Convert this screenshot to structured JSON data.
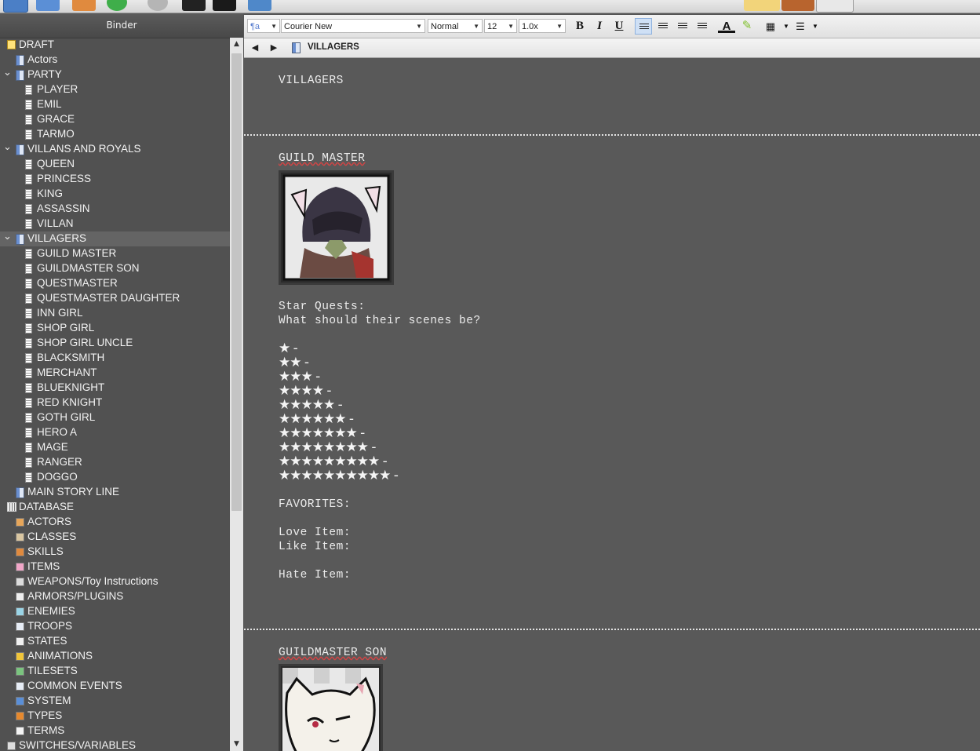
{
  "binder": {
    "header": "Binder",
    "items": [
      {
        "label": "DRAFT",
        "level": 0,
        "icon": "draft-icon",
        "expand": ""
      },
      {
        "label": "Actors",
        "level": 1,
        "icon": "folder-icon",
        "expand": ""
      },
      {
        "label": "PARTY",
        "level": 1,
        "icon": "folder-icon",
        "expand": "open"
      },
      {
        "label": "PLAYER",
        "level": 2,
        "icon": "document-icon",
        "expand": ""
      },
      {
        "label": "EMIL",
        "level": 2,
        "icon": "document-icon",
        "expand": ""
      },
      {
        "label": "GRACE",
        "level": 2,
        "icon": "document-icon",
        "expand": ""
      },
      {
        "label": "TARMO",
        "level": 2,
        "icon": "document-icon",
        "expand": ""
      },
      {
        "label": "VILLANS AND ROYALS",
        "level": 1,
        "icon": "folder-icon",
        "expand": "open"
      },
      {
        "label": "QUEEN",
        "level": 2,
        "icon": "document-icon",
        "expand": ""
      },
      {
        "label": "PRINCESS",
        "level": 2,
        "icon": "document-icon",
        "expand": ""
      },
      {
        "label": "KING",
        "level": 2,
        "icon": "document-icon",
        "expand": ""
      },
      {
        "label": "ASSASSIN",
        "level": 2,
        "icon": "document-icon",
        "expand": ""
      },
      {
        "label": "VILLAN",
        "level": 2,
        "icon": "document-icon",
        "expand": ""
      },
      {
        "label": "VILLAGERS",
        "level": 1,
        "icon": "folder-icon",
        "expand": "open",
        "selected": true
      },
      {
        "label": "GUILD MASTER",
        "level": 2,
        "icon": "document-icon",
        "expand": ""
      },
      {
        "label": "GUILDMASTER SON",
        "level": 2,
        "icon": "document-icon",
        "expand": ""
      },
      {
        "label": "QUESTMASTER",
        "level": 2,
        "icon": "document-icon",
        "expand": ""
      },
      {
        "label": "QUESTMASTER DAUGHTER",
        "level": 2,
        "icon": "document-icon",
        "expand": ""
      },
      {
        "label": "INN GIRL",
        "level": 2,
        "icon": "document-icon",
        "expand": ""
      },
      {
        "label": "SHOP GIRL",
        "level": 2,
        "icon": "document-icon",
        "expand": ""
      },
      {
        "label": "SHOP GIRL UNCLE",
        "level": 2,
        "icon": "document-icon",
        "expand": ""
      },
      {
        "label": "BLACKSMITH",
        "level": 2,
        "icon": "document-icon",
        "expand": ""
      },
      {
        "label": "MERCHANT",
        "level": 2,
        "icon": "document-icon",
        "expand": ""
      },
      {
        "label": "BLUEKNIGHT",
        "level": 2,
        "icon": "document-icon",
        "expand": ""
      },
      {
        "label": "RED KNIGHT",
        "level": 2,
        "icon": "document-icon",
        "expand": ""
      },
      {
        "label": "GOTH GIRL",
        "level": 2,
        "icon": "document-icon",
        "expand": ""
      },
      {
        "label": "HERO A",
        "level": 2,
        "icon": "document-icon",
        "expand": ""
      },
      {
        "label": "MAGE",
        "level": 2,
        "icon": "document-icon",
        "expand": ""
      },
      {
        "label": "RANGER",
        "level": 2,
        "icon": "document-icon",
        "expand": ""
      },
      {
        "label": "DOGGO",
        "level": 2,
        "icon": "document-icon",
        "expand": ""
      },
      {
        "label": "MAIN STORY LINE",
        "level": 1,
        "icon": "folder-icon",
        "expand": ""
      },
      {
        "label": "DATABASE",
        "level": 0,
        "icon": "grid-icon",
        "expand": ""
      },
      {
        "label": "ACTORS",
        "level": 1,
        "icon": "actor-icon",
        "expand": ""
      },
      {
        "label": "CLASSES",
        "level": 1,
        "icon": "class-icon",
        "expand": ""
      },
      {
        "label": "SKILLS",
        "level": 1,
        "icon": "skill-icon",
        "expand": ""
      },
      {
        "label": "ITEMS",
        "level": 1,
        "icon": "potion-icon",
        "expand": ""
      },
      {
        "label": "WEAPONS/Toy Instructions",
        "level": 1,
        "icon": "weapon-icon",
        "expand": ""
      },
      {
        "label": "ARMORS/PLUGINS",
        "level": 1,
        "icon": "armor-icon",
        "expand": ""
      },
      {
        "label": "ENEMIES",
        "level": 1,
        "icon": "eye-icon",
        "expand": ""
      },
      {
        "label": "TROOPS",
        "level": 1,
        "icon": "troops-icon",
        "expand": ""
      },
      {
        "label": "STATES",
        "level": 1,
        "icon": "states-icon",
        "expand": ""
      },
      {
        "label": "ANIMATIONS",
        "level": 1,
        "icon": "star-icon",
        "expand": ""
      },
      {
        "label": "TILESETS",
        "level": 1,
        "icon": "tileset-icon",
        "expand": ""
      },
      {
        "label": "COMMON EVENTS",
        "level": 1,
        "icon": "events-icon",
        "expand": ""
      },
      {
        "label": "SYSTEM",
        "level": 1,
        "icon": "system-icon",
        "expand": ""
      },
      {
        "label": "TYPES",
        "level": 1,
        "icon": "types-icon",
        "expand": ""
      },
      {
        "label": "TERMS",
        "level": 1,
        "icon": "terms-icon",
        "expand": ""
      },
      {
        "label": "SWITCHES/VARIABLES",
        "level": 0,
        "icon": "switch-icon",
        "expand": ""
      }
    ]
  },
  "format": {
    "style_icon": "¶a",
    "font": "Courier New",
    "paragraph_style": "Normal",
    "size": "12",
    "spacing": "1.0x",
    "bold": "B",
    "italic": "I",
    "underline": "U",
    "text_color_glyph": "A"
  },
  "nav": {
    "title": "VILLAGERS"
  },
  "editor": {
    "heading": "VILLAGERS",
    "guild_master": {
      "name": "GUILD MASTER",
      "star_quests": "Star Quests:",
      "question": "What should their scenes be?",
      "star_rows": [
        "★ -",
        "★★ -",
        "★★★ -",
        "★★★★ -",
        "★★★★★ -",
        "★★★★★★ -",
        "★★★★★★★ -",
        "★★★★★★★★ -",
        "★★★★★★★★★ -",
        "★★★★★★★★★★ -"
      ],
      "favorites": "FAVORITES:",
      "love": "Love Item:",
      "like": "Like Item:",
      "hate": "Hate Item:"
    },
    "guildmaster_son": {
      "name": "GUILDMASTER SON"
    }
  },
  "colors": {
    "background": "#555555",
    "editor_bg": "#595959",
    "text": "#ececec",
    "selected_row": "#646464"
  }
}
